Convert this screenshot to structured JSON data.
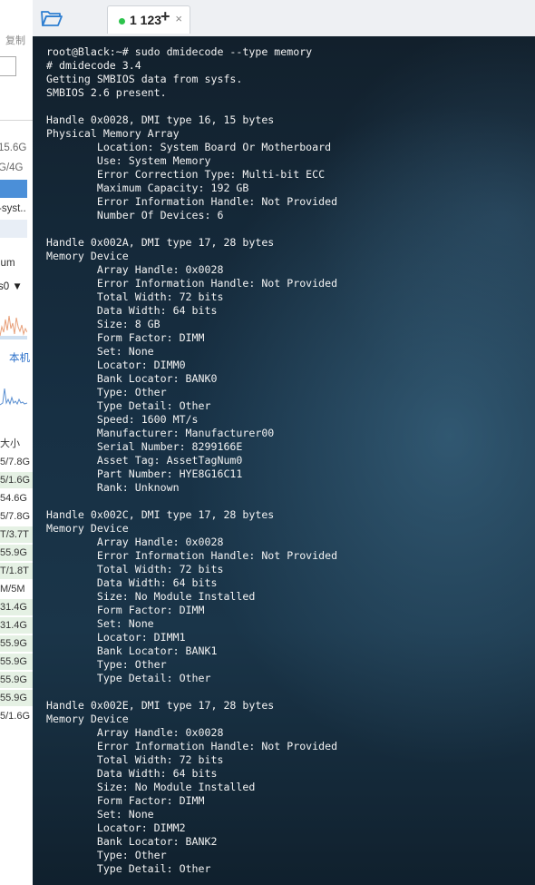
{
  "left_panel": {
    "copy_label": "复制",
    "texts": [
      "15.6G",
      "G/4G",
      "-syst..",
      "ium",
      "s0",
      "本机"
    ],
    "table_header": "大小",
    "rows": [
      "5/7.8G",
      "5/1.6G",
      "54.6G",
      "5/7.8G",
      "T/3.7T",
      "55.9G",
      "T/1.8T",
      "M/5M",
      "31.4G",
      "31.4G",
      "55.9G",
      "55.9G",
      "55.9G",
      "55.9G",
      "5/1.6G"
    ]
  },
  "tabbar": {
    "tab_label": "1 123",
    "close_glyph": "×",
    "add_glyph": "+"
  },
  "terminal": {
    "lines": [
      "root@Black:~# sudo dmidecode --type memory",
      "# dmidecode 3.4",
      "Getting SMBIOS data from sysfs.",
      "SMBIOS 2.6 present.",
      "",
      "Handle 0x0028, DMI type 16, 15 bytes",
      "Physical Memory Array",
      "        Location: System Board Or Motherboard",
      "        Use: System Memory",
      "        Error Correction Type: Multi-bit ECC",
      "        Maximum Capacity: 192 GB",
      "        Error Information Handle: Not Provided",
      "        Number Of Devices: 6",
      "",
      "Handle 0x002A, DMI type 17, 28 bytes",
      "Memory Device",
      "        Array Handle: 0x0028",
      "        Error Information Handle: Not Provided",
      "        Total Width: 72 bits",
      "        Data Width: 64 bits",
      "        Size: 8 GB",
      "        Form Factor: DIMM",
      "        Set: None",
      "        Locator: DIMM0",
      "        Bank Locator: BANK0",
      "        Type: Other",
      "        Type Detail: Other",
      "        Speed: 1600 MT/s",
      "        Manufacturer: Manufacturer00",
      "        Serial Number: 8299166E",
      "        Asset Tag: AssetTagNum0",
      "        Part Number: HYE8G16C11",
      "        Rank: Unknown",
      "",
      "Handle 0x002C, DMI type 17, 28 bytes",
      "Memory Device",
      "        Array Handle: 0x0028",
      "        Error Information Handle: Not Provided",
      "        Total Width: 72 bits",
      "        Data Width: 64 bits",
      "        Size: No Module Installed",
      "        Form Factor: DIMM",
      "        Set: None",
      "        Locator: DIMM1",
      "        Bank Locator: BANK1",
      "        Type: Other",
      "        Type Detail: Other",
      "",
      "Handle 0x002E, DMI type 17, 28 bytes",
      "Memory Device",
      "        Array Handle: 0x0028",
      "        Error Information Handle: Not Provided",
      "        Total Width: 72 bits",
      "        Data Width: 64 bits",
      "        Size: No Module Installed",
      "        Form Factor: DIMM",
      "        Set: None",
      "        Locator: DIMM2",
      "        Bank Locator: BANK2",
      "        Type: Other",
      "        Type Detail: Other"
    ]
  },
  "colors": {
    "tab_active_dot": "#2cc34c",
    "terminal_text": "#f2f2f2",
    "selection_blue": "#4b8fd8"
  },
  "icons": {
    "folder": "folder-open-icon",
    "close": "close-icon",
    "add": "plus-icon"
  }
}
